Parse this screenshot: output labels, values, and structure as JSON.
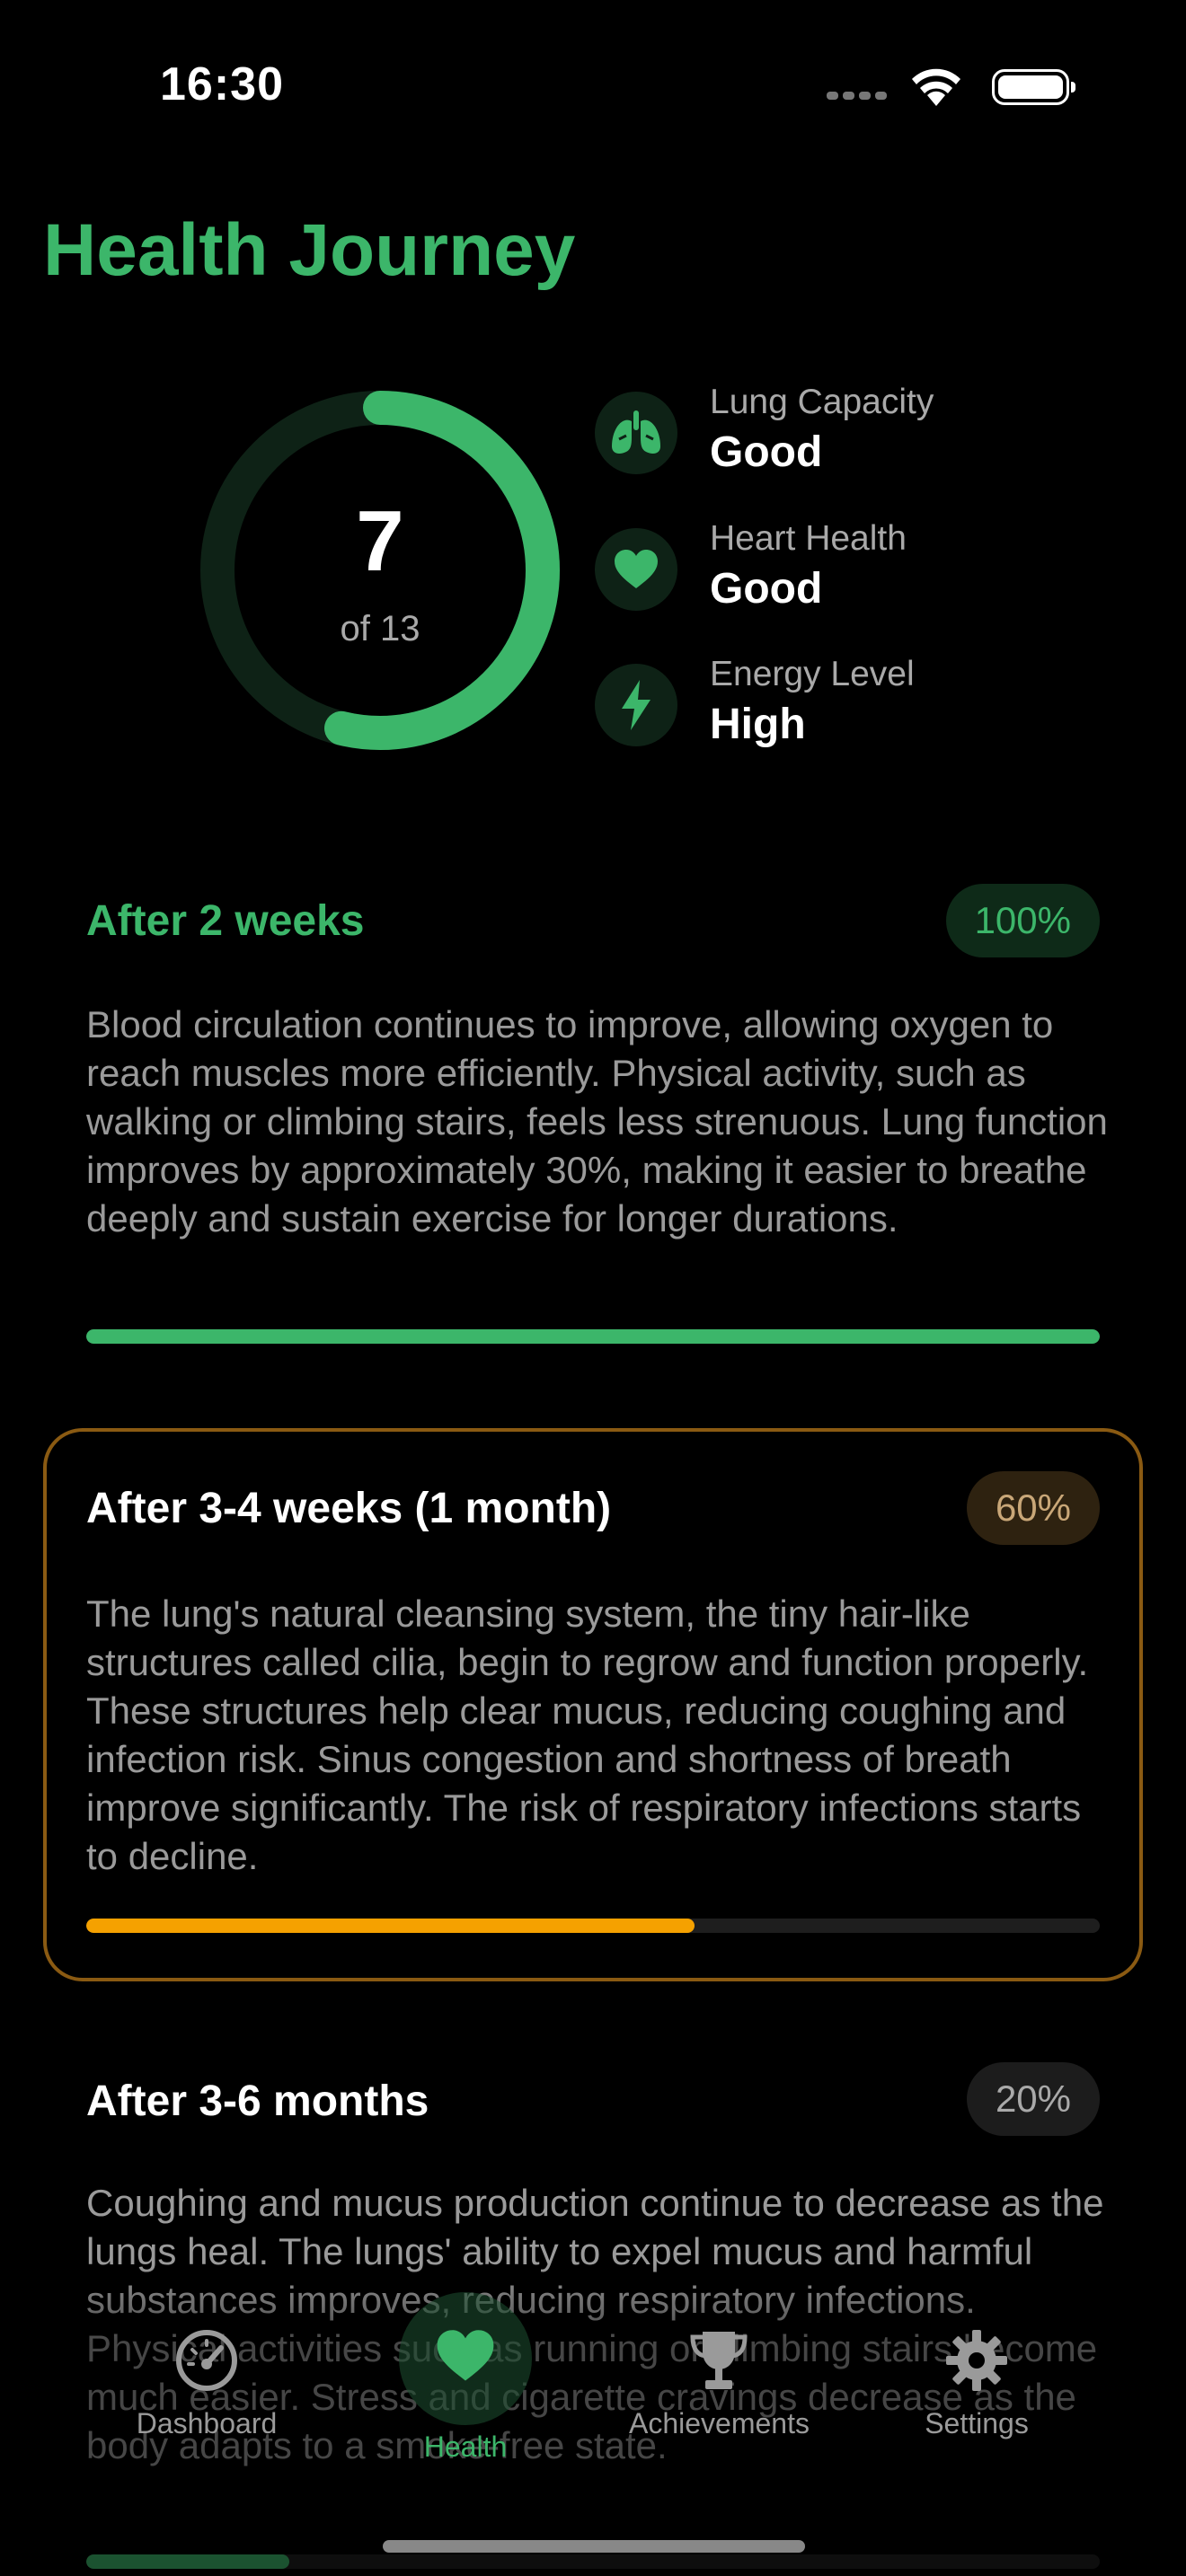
{
  "status_bar": {
    "time": "16:30"
  },
  "header": {
    "title": "Health Journey"
  },
  "progress_ring": {
    "current": "7",
    "caption": "of 13",
    "fraction": 0.538,
    "color": "#3cb66a",
    "track_color": "#0e2216"
  },
  "metrics": [
    {
      "label": "Lung Capacity",
      "value": "Good",
      "icon": "lungs-icon"
    },
    {
      "label": "Heart Health",
      "value": "Good",
      "icon": "heart-icon"
    },
    {
      "label": "Energy Level",
      "value": "High",
      "icon": "lightning-icon"
    }
  ],
  "milestones": [
    {
      "title": "After 2 weeks",
      "percent_label": "100%",
      "progress": 1.0,
      "status": "completed",
      "color": "#3cb66a",
      "body": "Blood circulation continues to improve, allowing oxygen to reach muscles more efficiently. Physical activity, such as walking or climbing stairs, feels less strenuous. Lung function improves by approximately 30%, making it easier to breathe deeply and sustain exercise for longer durations."
    },
    {
      "title": "After 3-4 weeks (1 month)",
      "percent_label": "60%",
      "progress": 0.6,
      "status": "current",
      "color": "#f5a100",
      "body": "The lung's natural cleansing system, the tiny hair-like structures called cilia, begin to regrow and function properly. These structures help clear mucus, reducing coughing and infection risk. Sinus congestion and shortness of breath improve significantly. The risk of respiratory infections starts to decline."
    },
    {
      "title": "After 3-6 months",
      "percent_label": "20%",
      "progress": 0.2,
      "status": "upcoming",
      "color": "#3cb66a",
      "body": "Coughing and mucus production continue to decrease as the lungs heal. The lungs' ability to expel mucus and harmful substances improves, reducing respiratory infections. Physical activities such as running or climbing stairs become much easier. Stress and cigarette cravings decrease as the body adapts to a smoke-free state."
    }
  ],
  "tab_bar": {
    "tabs": [
      {
        "label": "Dashboard",
        "icon": "speedometer-icon",
        "active": false
      },
      {
        "label": "Health",
        "icon": "heart-icon",
        "active": true
      },
      {
        "label": "Achievements",
        "icon": "trophy-icon",
        "active": false
      },
      {
        "label": "Settings",
        "icon": "gear-icon",
        "active": false
      }
    ]
  },
  "colors": {
    "accent_green": "#3cb66a",
    "accent_orange": "#f5a100",
    "background": "#000000"
  }
}
